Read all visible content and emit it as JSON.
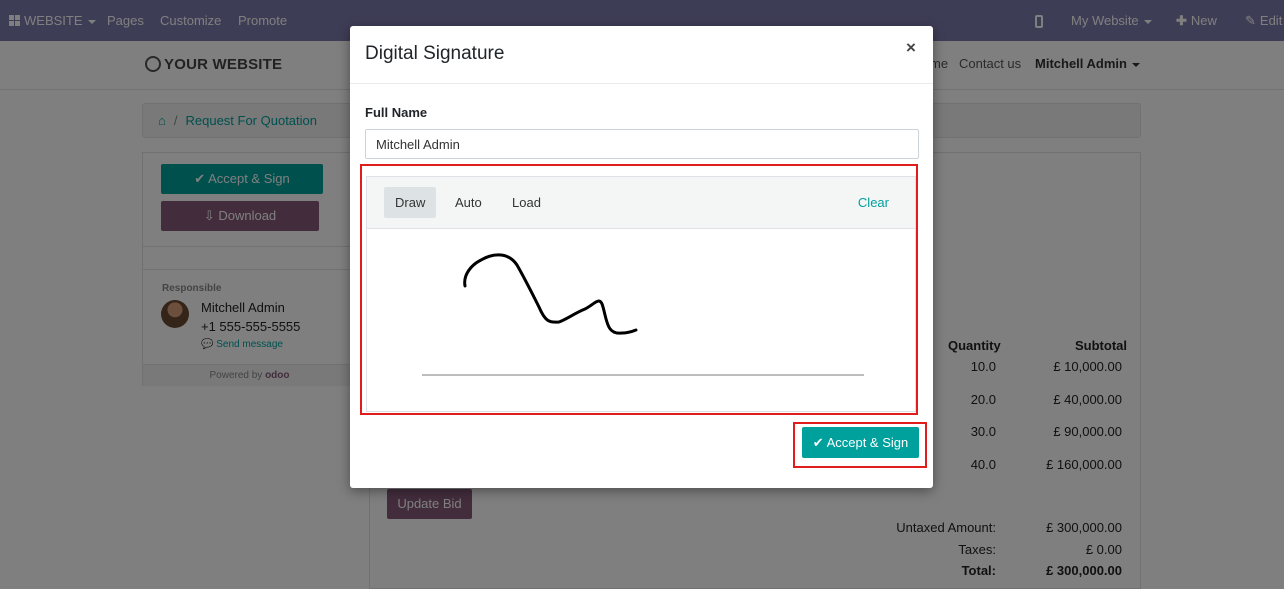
{
  "topbar": {
    "website_menu": "WEBSITE",
    "pages": "Pages",
    "customize": "Customize",
    "promote": "Promote",
    "my_website": "My Website",
    "new": "New",
    "edit": "Edit"
  },
  "header": {
    "logo_text": "YOUR WEBSITE",
    "nav_home_fragment": "me",
    "contact_us": "Contact us",
    "user": "Mitchell Admin"
  },
  "breadcrumb": {
    "current": "Request For Quotation"
  },
  "sidebar": {
    "accept_sign_label": "Accept & Sign",
    "download_label": "Download",
    "responsible_label": "Responsible",
    "person_name": "Mitchell Admin",
    "person_phone": "+1 555-555-5555",
    "send_message": "Send message",
    "powered_by": "Powered by",
    "odoo": "odoo"
  },
  "table": {
    "col_quantity": "Quantity",
    "col_subtotal": "Subtotal",
    "rows": [
      {
        "quantity": "10.0",
        "subtotal": "£ 10,000.00"
      },
      {
        "quantity": "20.0",
        "subtotal": "£ 40,000.00"
      },
      {
        "quantity": "30.0",
        "subtotal": "£ 90,000.00"
      },
      {
        "quantity": "40.0",
        "subtotal": "£ 160,000.00"
      }
    ],
    "update_bid": "Update Bid",
    "untaxed_label": "Untaxed Amount:",
    "untaxed_value": "£ 300,000.00",
    "taxes_label": "Taxes:",
    "taxes_value": "£ 0.00",
    "total_label": "Total:",
    "total_value": "£ 300,000.00"
  },
  "modal": {
    "title": "Digital Signature",
    "close_glyph": "×",
    "full_name_label": "Full Name",
    "full_name_value": "Mitchell Admin",
    "tabs": {
      "draw": "Draw",
      "auto": "Auto",
      "load": "Load"
    },
    "active_tab": "Draw",
    "clear": "Clear",
    "accept_sign": "Accept & Sign"
  },
  "colors": {
    "topbar": "#7c7bad",
    "primary": "#00a09d",
    "secondary": "#875a7b",
    "highlight": "#e01c1c"
  }
}
